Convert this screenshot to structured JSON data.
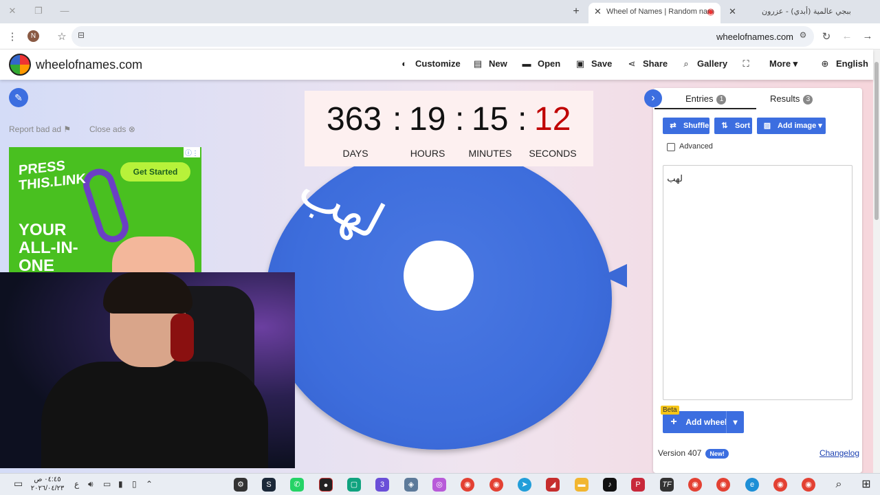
{
  "browser": {
    "tabs": [
      {
        "title": "Wheel of Names | Random nam",
        "active": true
      },
      {
        "title": "ببجي عالمية (أبدي) - عزرون",
        "active": false
      }
    ],
    "new_tab_label": "+",
    "profile_initial": "N",
    "url": "wheelofnames.com"
  },
  "site": {
    "brand": "wheelofnames.com",
    "menu": [
      {
        "icon": "palette-icon",
        "glyph": "◐",
        "label": "Customize"
      },
      {
        "icon": "file-icon",
        "glyph": "▤",
        "label": "New"
      },
      {
        "icon": "folder-icon",
        "glyph": "▬",
        "label": "Open"
      },
      {
        "icon": "save-icon",
        "glyph": "▣",
        "label": "Save"
      },
      {
        "icon": "share-icon",
        "glyph": "⋖",
        "label": "Share"
      },
      {
        "icon": "search-icon",
        "glyph": "⌕",
        "label": "Gallery"
      },
      {
        "icon": "fullscreen-icon",
        "glyph": "⛶",
        "label": ""
      },
      {
        "icon": "more-icon",
        "glyph": "",
        "label": "More ▾"
      },
      {
        "icon": "globe-icon",
        "glyph": "⊕",
        "label": "English"
      }
    ]
  },
  "ads": {
    "report_label": "Report bad ad",
    "close_label": "Close ads",
    "headline": "PRESS THIS.LINK",
    "body": "YOUR ALL-IN-ONE TOOL FOR",
    "cta": "Get Started"
  },
  "countdown": {
    "days": "363",
    "hours": "19",
    "minutes": "15",
    "seconds": "12",
    "days_label": "DAYS",
    "hours_label": "HOURS",
    "minutes_label": "MINUTES",
    "seconds_label": "SECONDS",
    "separator": ":"
  },
  "wheel": {
    "segment_text": "لهب",
    "color": "#3d6ddc"
  },
  "panel": {
    "tab_entries": "Entries",
    "entries_count": "1",
    "tab_results": "Results",
    "results_count": "3",
    "shuffle_label": "Shuffle",
    "sort_label": "Sort",
    "add_image_label": "Add image",
    "advanced_label": "Advanced",
    "entries_text": "لهب",
    "beta_label": "Beta",
    "add_wheel_label": "Add wheel",
    "version": "Version 407",
    "new_badge": "New!",
    "changelog": "Changelog"
  },
  "taskbar": {
    "time": "٠٤:٤٥ ص",
    "date": "٢٠٢٦/٠٤/٢٣",
    "lang": "ع"
  },
  "colors": {
    "accent": "#3c6ee0",
    "seconds": "#c00000"
  }
}
